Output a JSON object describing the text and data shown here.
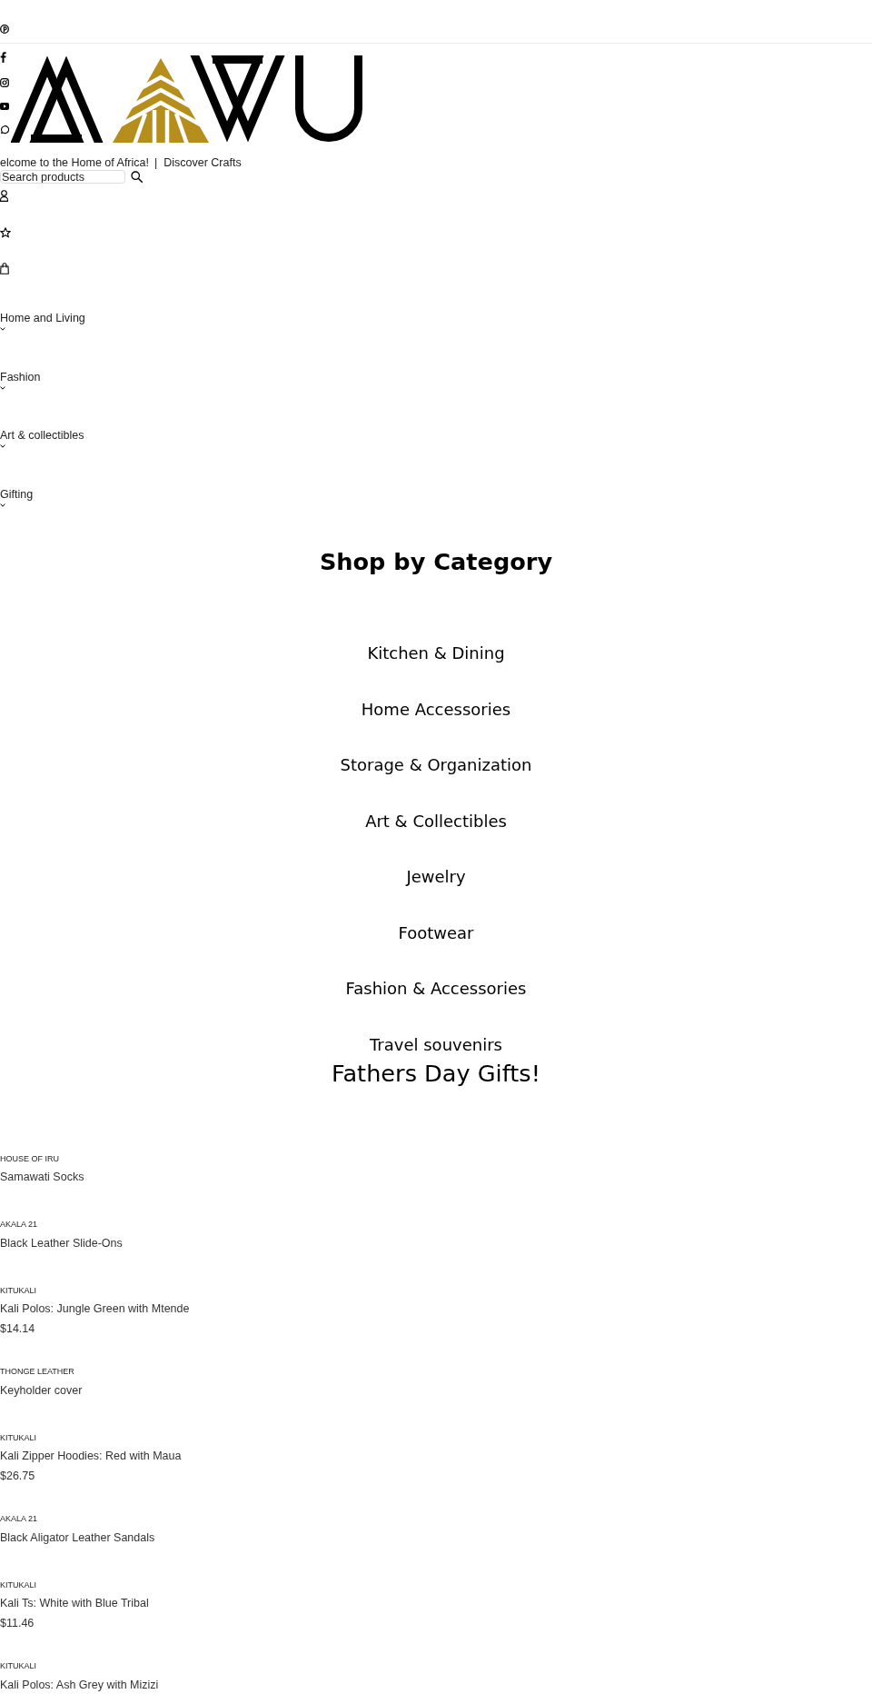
{
  "header": {
    "welcome_text": "elcome to the Home of Africa!",
    "separator": "|",
    "link": "Discover Crafts",
    "search": {
      "placeholder": "Search products"
    }
  },
  "nav": {
    "items": [
      {
        "label": "Home and Living"
      },
      {
        "label": "Fashion"
      },
      {
        "label": "Art & collectibles"
      },
      {
        "label": "Gifting"
      }
    ]
  },
  "categories": {
    "title": "Shop by Category",
    "items": [
      {
        "label": "Kitchen & Dining"
      },
      {
        "label": "Home Accessories"
      },
      {
        "label": "Storage & Organization"
      },
      {
        "label": "Art & Collectibles"
      },
      {
        "label": "Jewelry"
      },
      {
        "label": "Footwear"
      },
      {
        "label": "Fashion & Accessories"
      },
      {
        "label": "Travel souvenirs"
      }
    ]
  },
  "featured": {
    "title": "Fathers Day Gifts!",
    "products": [
      {
        "brand": "HOUSE OF IRU",
        "name": "Samawati Socks"
      },
      {
        "brand": "AKALA 21",
        "name": "Black Leather Slide-Ons"
      },
      {
        "brand": "KITUKALI",
        "name": "Kali Polos: Jungle Green with Mtende",
        "price": "$14.14"
      },
      {
        "brand": "THONGE LEATHER",
        "name": "Keyholder cover"
      },
      {
        "brand": "KITUKALI",
        "name": "Kali Zipper Hoodies: Red with Maua",
        "price": "$26.75"
      },
      {
        "brand": "AKALA 21",
        "name": "Black Aligator Leather Sandals"
      },
      {
        "brand": "KITUKALI",
        "name": "Kali Ts: White with Blue Tribal",
        "price": "$11.46"
      },
      {
        "brand": "KITUKALI",
        "name": "Kali Polos: Ash Grey with Mizizi"
      }
    ]
  }
}
